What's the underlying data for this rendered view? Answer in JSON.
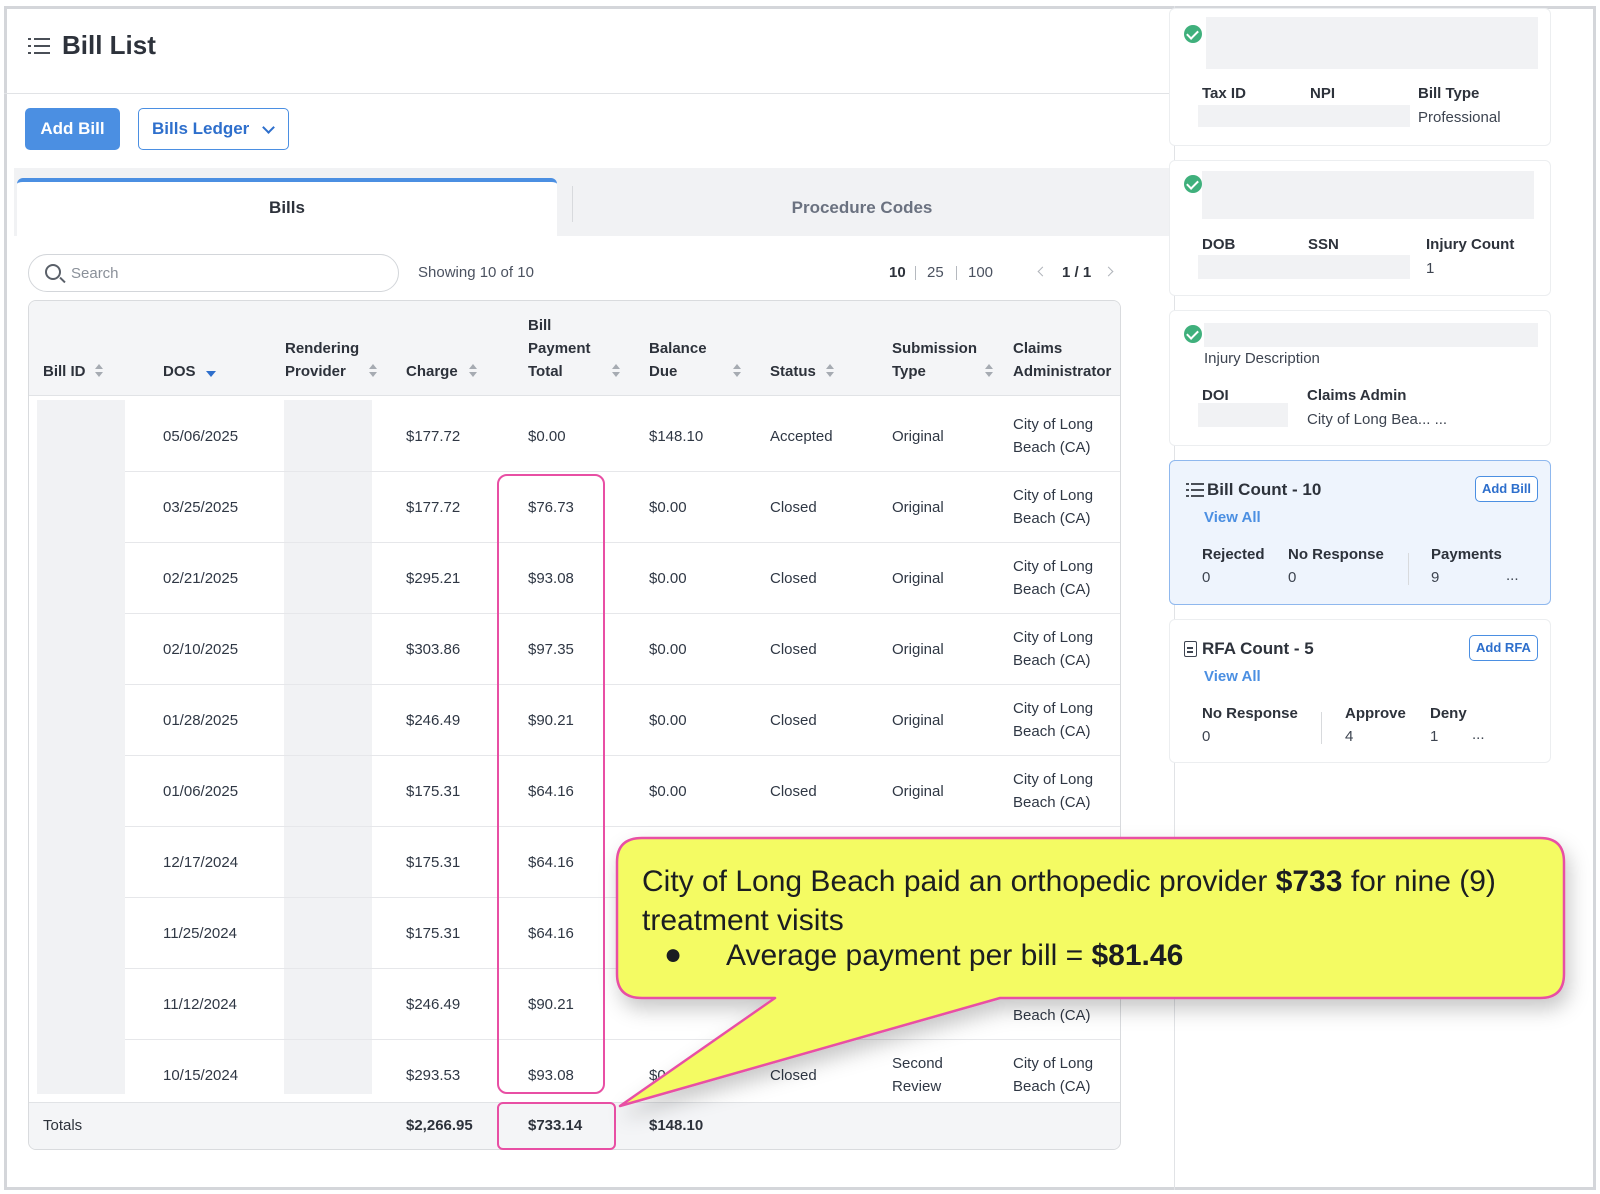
{
  "page": {
    "title": "Bill List"
  },
  "toolbar": {
    "add_bill_label": "Add Bill",
    "ledger_label": "Bills Ledger"
  },
  "tabs": [
    {
      "label": "Bills"
    },
    {
      "label": "Procedure Codes"
    }
  ],
  "search": {
    "placeholder": "Search",
    "value": ""
  },
  "showing": "Showing 10 of 10",
  "page_sizes": [
    "10",
    "25",
    "100"
  ],
  "pager": "1 / 1",
  "table": {
    "headers": {
      "bill_id": "Bill ID",
      "dos": "DOS",
      "rendering_provider": [
        "Rendering",
        "Provider"
      ],
      "charge": "Charge",
      "payment": [
        "Bill",
        "Payment",
        "Total"
      ],
      "balance": [
        "Balance",
        "Due"
      ],
      "status": "Status",
      "submission": [
        "Submission",
        "Type"
      ],
      "claims_admin": [
        "Claims",
        "Administrator"
      ]
    },
    "rows": [
      {
        "dos": "05/06/2025",
        "charge": "$177.72",
        "payment": "$0.00",
        "balance": "$148.10",
        "status": "Accepted",
        "submission": [
          "Original"
        ],
        "admin": [
          "City of Long",
          "Beach (CA)"
        ]
      },
      {
        "dos": "03/25/2025",
        "charge": "$177.72",
        "payment": "$76.73",
        "balance": "$0.00",
        "status": "Closed",
        "submission": [
          "Original"
        ],
        "admin": [
          "City of Long",
          "Beach (CA)"
        ]
      },
      {
        "dos": "02/21/2025",
        "charge": "$295.21",
        "payment": "$93.08",
        "balance": "$0.00",
        "status": "Closed",
        "submission": [
          "Original"
        ],
        "admin": [
          "City of Long",
          "Beach (CA)"
        ]
      },
      {
        "dos": "02/10/2025",
        "charge": "$303.86",
        "payment": "$97.35",
        "balance": "$0.00",
        "status": "Closed",
        "submission": [
          "Original"
        ],
        "admin": [
          "City of Long",
          "Beach (CA)"
        ]
      },
      {
        "dos": "01/28/2025",
        "charge": "$246.49",
        "payment": "$90.21",
        "balance": "$0.00",
        "status": "Closed",
        "submission": [
          "Original"
        ],
        "admin": [
          "City of Long",
          "Beach (CA)"
        ]
      },
      {
        "dos": "01/06/2025",
        "charge": "$175.31",
        "payment": "$64.16",
        "balance": "$0.00",
        "status": "Closed",
        "submission": [
          "Original"
        ],
        "admin": [
          "City of Long",
          "Beach (CA)"
        ]
      },
      {
        "dos": "12/17/2024",
        "charge": "$175.31",
        "payment": "$64.16",
        "balance": "",
        "status": "",
        "submission": [
          ""
        ],
        "admin": [
          "",
          ""
        ]
      },
      {
        "dos": "11/25/2024",
        "charge": "$175.31",
        "payment": "$64.16",
        "balance": "",
        "status": "",
        "submission": [
          ""
        ],
        "admin": [
          "",
          ""
        ]
      },
      {
        "dos": "11/12/2024",
        "charge": "$246.49",
        "payment": "$90.21",
        "balance": "",
        "status": "",
        "submission": [
          ""
        ],
        "admin": [
          "",
          "Beach (CA)"
        ]
      },
      {
        "dos": "10/15/2024",
        "charge": "$293.53",
        "payment": "$93.08",
        "balance": "$0.0",
        "status": "Closed",
        "submission": [
          "Second",
          "Review"
        ],
        "admin": [
          "City of Long",
          "Beach (CA)"
        ]
      }
    ],
    "totals": {
      "label": "Totals",
      "charge": "$2,266.95",
      "payment": "$733.14",
      "balance": "$148.10"
    }
  },
  "callout": {
    "line1_a": "City of Long Beach paid an orthopedic provider ",
    "line1_b": "$733",
    "line1_c": " for nine (9) treatment visits",
    "bullet": "●",
    "bullet_a": "Average payment per bill = ",
    "bullet_b": "$81.46",
    "fill": "#f4fb64",
    "border": "#e84fa4"
  },
  "side": {
    "provider": {
      "tax_id": "Tax ID",
      "npi": "NPI",
      "bill_type_label": "Bill Type",
      "bill_type_value": "Professional"
    },
    "patient": {
      "dob": "DOB",
      "ssn": "SSN",
      "injury_count_label": "Injury Count",
      "injury_count_value": "1"
    },
    "injury": {
      "desc_label": "Injury Description",
      "doi": "DOI",
      "claims_admin_label": "Claims Admin",
      "claims_admin_value": "City of Long Bea... ..."
    },
    "bills": {
      "title": "Bill Count - 10",
      "view_all": "View All",
      "add_label": "Add Bill",
      "rejected_label": "Rejected",
      "rejected_value": "0",
      "noresp_label": "No Response",
      "noresp_value": "0",
      "payments_label": "Payments",
      "payments_value": "9",
      "more": "..."
    },
    "rfa": {
      "title": "RFA Count - 5",
      "view_all": "View All",
      "add_label": "Add RFA",
      "noresp_label": "No Response",
      "noresp_value": "0",
      "approve_label": "Approve",
      "approve_value": "4",
      "deny_label": "Deny",
      "deny_value": "1",
      "more": "..."
    }
  }
}
